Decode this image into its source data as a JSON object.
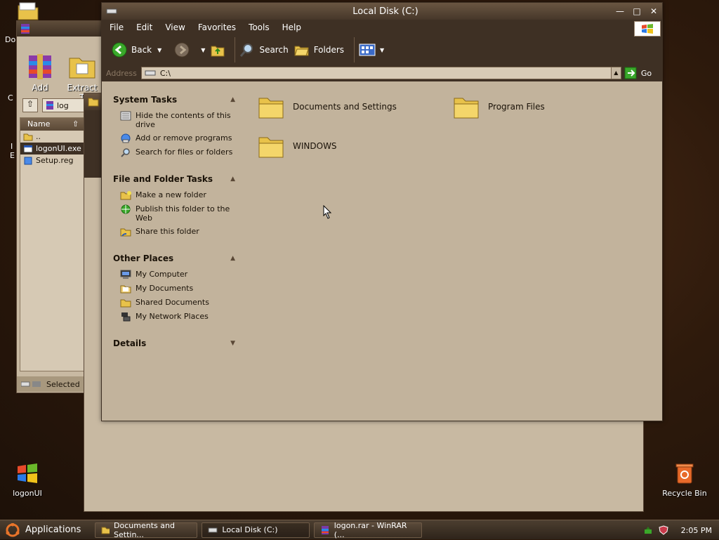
{
  "desktop": {
    "icons": [
      {
        "label": "logonUI"
      },
      {
        "label": "Recycle Bin"
      }
    ],
    "partial_labels": {
      "top_left": "Do",
      "mid_left": "C",
      "side_i": "I",
      "side_e": "E"
    }
  },
  "rar_window": {
    "toolbar": [
      {
        "label": "Add"
      },
      {
        "label": "Extract T"
      }
    ],
    "path_fragment": "log",
    "column_header": "Name",
    "rows": [
      {
        "name": ".."
      },
      {
        "name": "logonUI.exe"
      },
      {
        "name": "Setup.reg"
      }
    ],
    "status": "Selected"
  },
  "explorer": {
    "title": "Local Disk (C:)",
    "menu": [
      "File",
      "Edit",
      "View",
      "Favorites",
      "Tools",
      "Help"
    ],
    "toolbar": {
      "back": "Back",
      "search": "Search",
      "folders": "Folders"
    },
    "address": {
      "label": "Address",
      "value": "C:\\",
      "go": "Go"
    },
    "tasks": {
      "system": {
        "title": "System Tasks",
        "items": [
          {
            "label": "Hide the contents of this drive"
          },
          {
            "label": "Add or remove programs"
          },
          {
            "label": "Search for files or folders"
          }
        ]
      },
      "file_folder": {
        "title": "File and Folder Tasks",
        "items": [
          {
            "label": "Make a new folder"
          },
          {
            "label": "Publish this folder to the Web"
          },
          {
            "label": "Share this folder"
          }
        ]
      },
      "other": {
        "title": "Other Places",
        "items": [
          {
            "label": "My Computer"
          },
          {
            "label": "My Documents"
          },
          {
            "label": "Shared Documents"
          },
          {
            "label": "My Network Places"
          }
        ]
      },
      "details": {
        "title": "Details"
      }
    },
    "files": [
      {
        "name": "Documents and Settings"
      },
      {
        "name": "Program Files"
      },
      {
        "name": "WINDOWS"
      }
    ]
  },
  "taskbar": {
    "start": "Applications",
    "tasks": [
      {
        "label": "Documents and Settin..."
      },
      {
        "label": "Local Disk (C:)"
      },
      {
        "label": "logon.rar - WinRAR (..."
      }
    ],
    "clock": "2:05 PM"
  }
}
